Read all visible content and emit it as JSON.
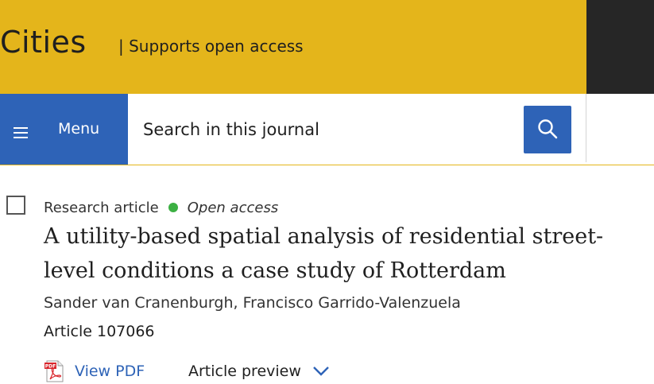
{
  "header": {
    "journal_title": "Cities",
    "tagline": "| Supports open access"
  },
  "nav": {
    "menu_label": "Menu",
    "menu_icon": "hamburger-icon",
    "search_placeholder": "Search in this journal",
    "search_icon": "search-icon"
  },
  "article": {
    "type": "Research article",
    "access": "Open access",
    "title": "A utility-based spatial analysis of residential street-level conditions a case study of Rotterdam",
    "authors": "Sander van Cranenburgh, Francisco Garrido-Valenzuela",
    "article_number": "Article 107066",
    "view_pdf_label": "View PDF",
    "pdf_icon": "pdf-file-icon",
    "preview_label": "Article preview",
    "preview_icon": "chevron-down-icon"
  },
  "colors": {
    "banner": "#e4b51b",
    "banner_dark": "#262626",
    "accent_blue": "#2e63b7",
    "open_access_green": "#3cb043"
  }
}
